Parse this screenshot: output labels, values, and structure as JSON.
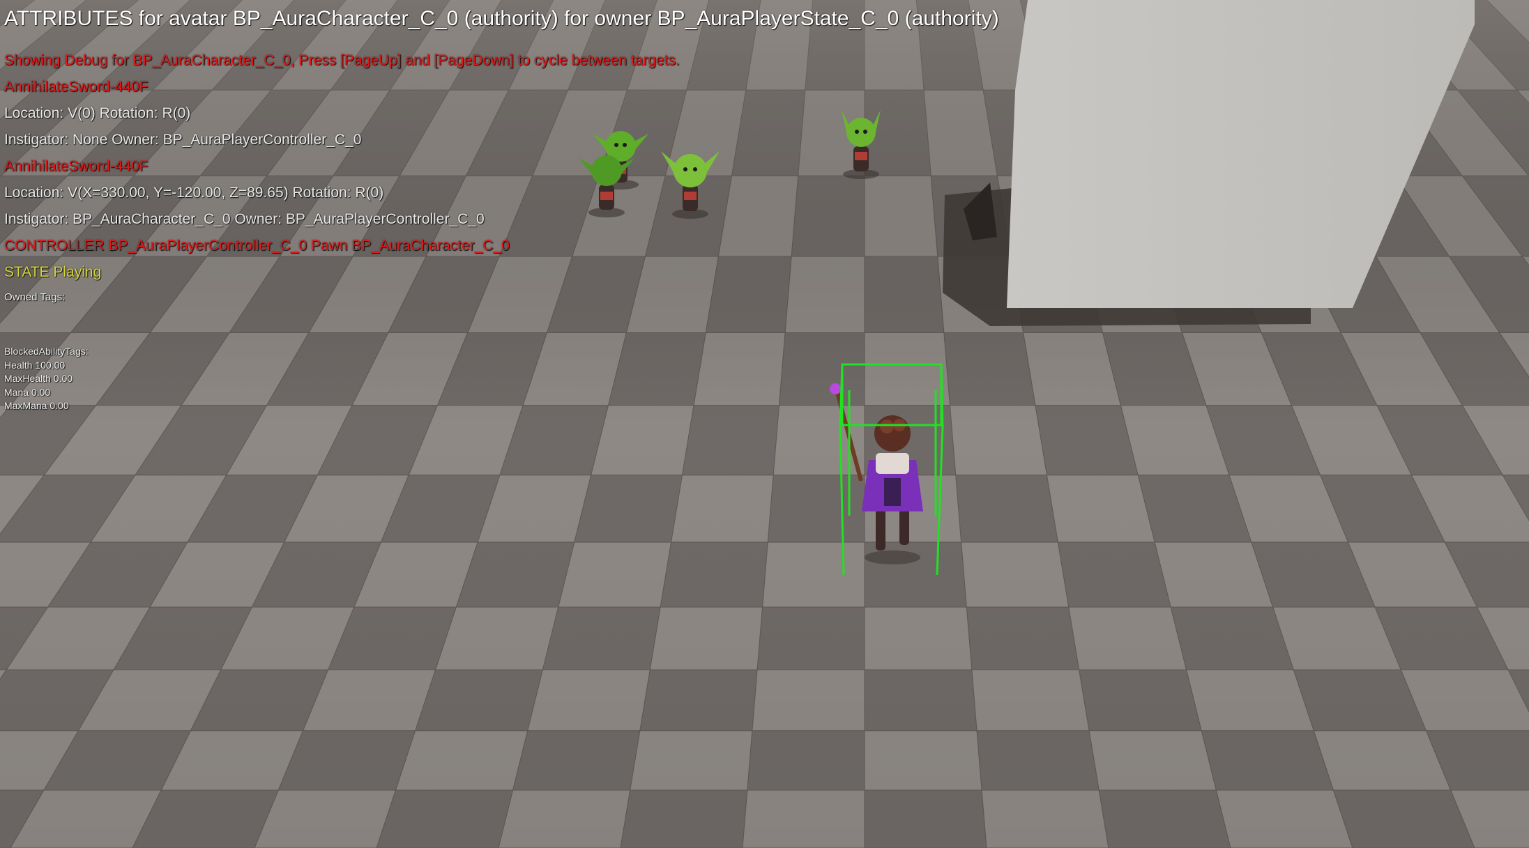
{
  "debug_overlay": {
    "title": "ATTRIBUTES for avatar BP_AuraCharacter_C_0 (authority) for owner BP_AuraPlayerState_C_0 (authority)",
    "showing_debug": "Showing Debug for BP_AuraCharacter_C_0, Press [PageUp] and [PageDown] to cycle between targets.",
    "effects": [
      {
        "name": "AnnihilateSword-440F",
        "location": "Location: V(0) Rotation: R(0)",
        "instigator": " Instigator: None Owner: BP_AuraPlayerController_C_0"
      },
      {
        "name": "AnnihilateSword-440F",
        "location": "Location: V(X=330.00, Y=-120.00, Z=89.65) Rotation: R(0)",
        "instigator": " Instigator: BP_AuraCharacter_C_0 Owner: BP_AuraPlayerController_C_0"
      }
    ],
    "controller": "CONTROLLER BP_AuraPlayerController_C_0 Pawn BP_AuraCharacter_C_0",
    "state": "STATE Playing",
    "owned_tags": "Owned Tags:",
    "blocked_ability_tags": "BlockedAbilityTags:",
    "attributes": [
      "Health 100.00",
      "MaxHealth 0.00",
      "Mana 0.00",
      "MaxMana 0.00"
    ]
  },
  "colors": {
    "debug_red": "#e21818",
    "state_yellow": "#d6d63a",
    "bounds_green": "#22e022",
    "floor_light": "#8e8985",
    "floor_dark": "#6f6a67"
  }
}
